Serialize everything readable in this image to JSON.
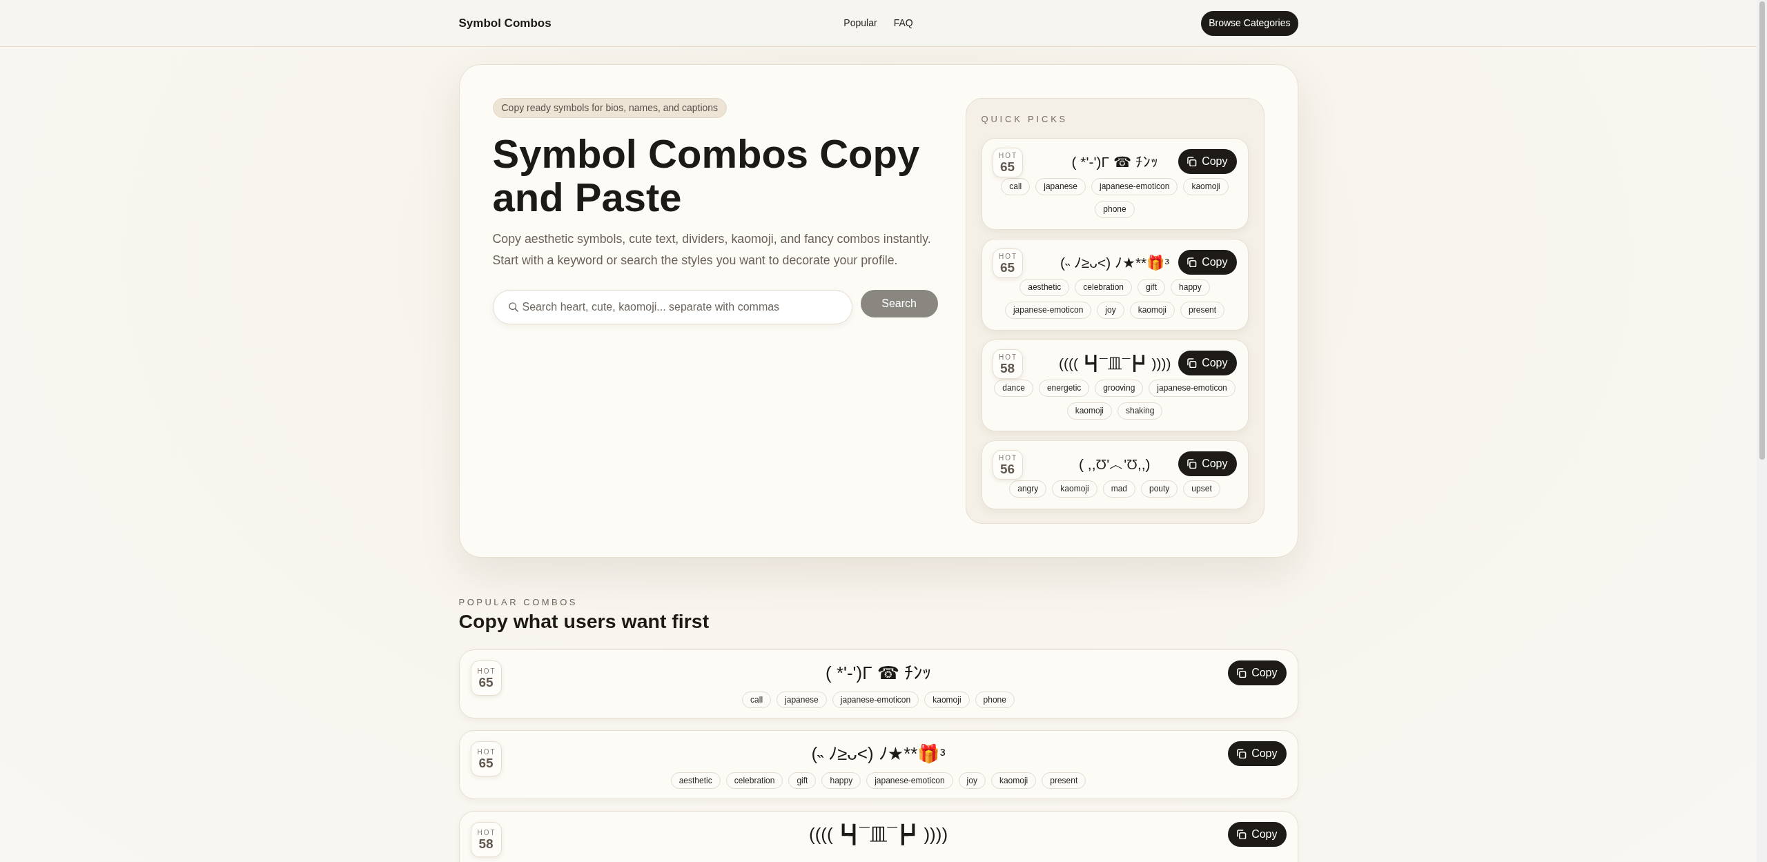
{
  "navbar": {
    "brand": "Symbol Combos",
    "links": [
      {
        "label": "Popular"
      },
      {
        "label": "FAQ"
      }
    ],
    "button": "Browse Categories"
  },
  "hero": {
    "badge": "Copy ready symbols for bios, names, and captions",
    "title": "Symbol Combos Copy and Paste",
    "description": "Copy aesthetic symbols, cute text, dividers, kaomoji, and fancy combos instantly. Start with a keyword or search the styles you want to decorate your profile.",
    "search": {
      "placeholder": "Search heart, cute, kaomoji... separate with commas",
      "button": "Search"
    }
  },
  "quick_picks": {
    "title": "QUICK PICKS",
    "items": [
      {
        "hot_label": "HOT",
        "score": "65",
        "combo": "( *'-')Γ ☎ ﾁﾝｯ",
        "copy_label": "Copy",
        "tags": [
          "call",
          "japanese",
          "japanese-emoticon",
          "kaomoji",
          "phone"
        ]
      },
      {
        "hot_label": "HOT",
        "score": "65",
        "combo": "(˵ ﾉ≥ᴗ<) ﾉ★**🎁ᵌ",
        "copy_label": "Copy",
        "tags": [
          "aesthetic",
          "celebration",
          "gift",
          "happy",
          "japanese-emoticon",
          "joy",
          "kaomoji",
          "present"
        ]
      },
      {
        "hot_label": "HOT",
        "score": "58",
        "combo": "(((( ┗┫¯皿¯┣┛ ))))",
        "copy_label": "Copy",
        "tags": [
          "dance",
          "energetic",
          "grooving",
          "japanese-emoticon",
          "kaomoji",
          "shaking"
        ]
      },
      {
        "hot_label": "HOT",
        "score": "56",
        "combo": "( ,,Ʊ'︿'Ʊ,,)",
        "copy_label": "Copy",
        "tags": [
          "angry",
          "kaomoji",
          "mad",
          "pouty",
          "upset"
        ]
      }
    ]
  },
  "popular": {
    "eyebrow": "POPULAR COMBOS",
    "heading": "Copy what users want first",
    "items": [
      {
        "hot_label": "HOT",
        "score": "65",
        "combo": "( *'-')Γ ☎ ﾁﾝｯ",
        "copy_label": "Copy",
        "tags": [
          "call",
          "japanese",
          "japanese-emoticon",
          "kaomoji",
          "phone"
        ]
      },
      {
        "hot_label": "HOT",
        "score": "65",
        "combo": "(˵ ﾉ≥ᴗ<) ﾉ★**🎁ᵌ",
        "copy_label": "Copy",
        "tags": [
          "aesthetic",
          "celebration",
          "gift",
          "happy",
          "japanese-emoticon",
          "joy",
          "kaomoji",
          "present"
        ]
      },
      {
        "hot_label": "HOT",
        "score": "58",
        "combo": "(((( ┗┫¯皿¯┣┛ ))))",
        "copy_label": "Copy"
      }
    ]
  }
}
